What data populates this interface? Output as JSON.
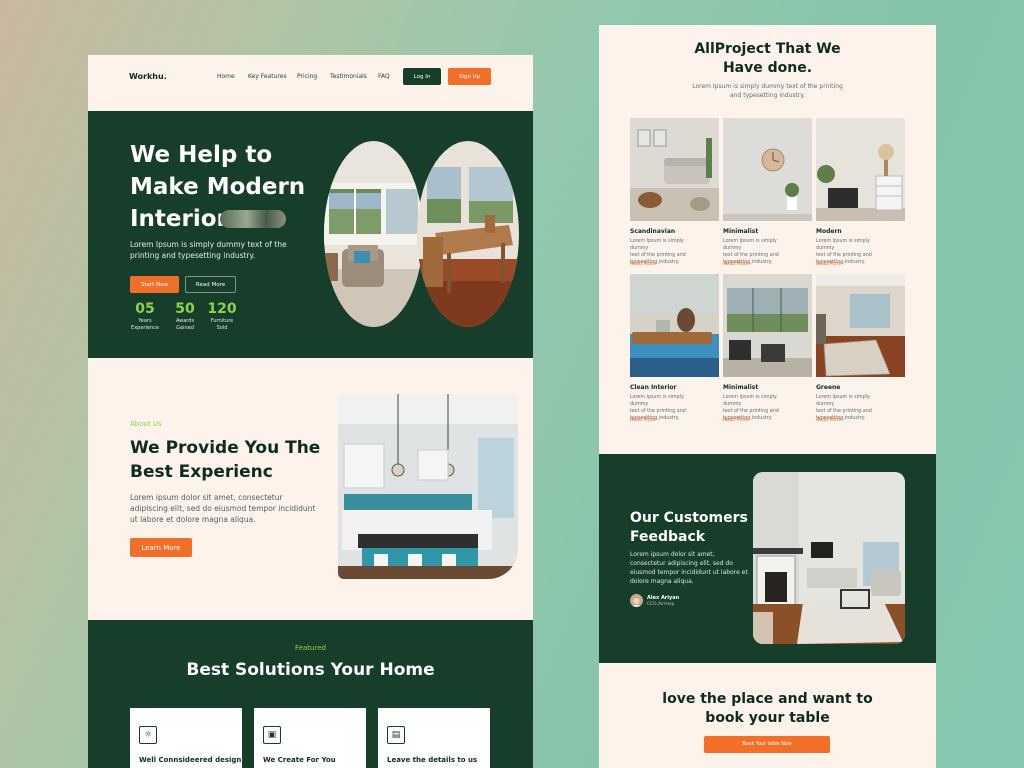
{
  "brand": {
    "logo": "Workhu.",
    "accent": "#f26f29",
    "dark_green": "#173d2b",
    "cream": "#fdf3ea",
    "lime": "#8fd14f"
  },
  "nav": {
    "links": [
      "Home",
      "Key Features",
      "Pricing",
      "Testimonials",
      "FAQ"
    ],
    "login": "Log In",
    "signup": "Sign Up"
  },
  "hero": {
    "title_lines": [
      "We Help to",
      "Make Modern",
      "Interior"
    ],
    "description": "Lorem Ipsum is simply dummy text of the printing and typesetting industry.",
    "start_button": "Start Now",
    "read_more_button": "Read More",
    "stats": [
      {
        "value": "05",
        "label_1": "Years",
        "label_2": "Experience"
      },
      {
        "value": "50",
        "label_1": "Awards",
        "label_2": "Gained"
      },
      {
        "value": "120",
        "label_1": "Furniture",
        "label_2": "Sold"
      }
    ]
  },
  "about": {
    "kicker": "About Us",
    "title_lines": [
      "We Provide You The",
      "Best Experienc"
    ],
    "description": "Lorem ipsum dolor sit amet, consectetur adipiscing elit, sed do eiusmod tempor incididunt ut labore et dolore magna aliqua.",
    "button": "Learn More"
  },
  "featured": {
    "kicker": "Featured",
    "title": "Best Solutions Your Home",
    "cards": [
      {
        "icon": "sun-icon",
        "title": "Well Connsideered design"
      },
      {
        "icon": "create-icon",
        "title": "We Create For You"
      },
      {
        "icon": "chat-icon",
        "title": "Leave the details to us"
      }
    ]
  },
  "projects": {
    "title_lines": [
      "AllProject That We",
      "Have done."
    ],
    "description_lines": [
      "Lorem Ipsum is simply dummy text of the printing",
      "and typesetting industry."
    ],
    "items": [
      {
        "name": "Scandinavian",
        "desc_lines": [
          "Lorem Ipsum is simply dummy",
          "text of the printing and",
          "typesetting industry."
        ],
        "read_more": "Read More"
      },
      {
        "name": "Minimalist",
        "desc_lines": [
          "Lorem Ipsum is simply dummy",
          "text of the printing and",
          "typesetting industry."
        ],
        "read_more": "Read More"
      },
      {
        "name": "Modern",
        "desc_lines": [
          "Lorem Ipsum is simply dummy",
          "text of the printing and",
          "typesetting industry."
        ],
        "read_more": "Read More"
      },
      {
        "name": "Clean Interior",
        "desc_lines": [
          "Lorem Ipsum is simply dummy",
          "text of the printing and",
          "typesetting industry."
        ],
        "read_more": "Read More"
      },
      {
        "name": "Minimalist",
        "desc_lines": [
          "Lorem Ipsum is simply dummy",
          "text of the printing and",
          "typesetting industry."
        ],
        "read_more": "Read More"
      },
      {
        "name": "Greene",
        "desc_lines": [
          "Lorem Ipsum is simply dummy",
          "text of the printing and",
          "typesetting industry."
        ],
        "read_more": "Read More"
      }
    ]
  },
  "feedback": {
    "title_lines": [
      "Our Customers",
      "Feedback"
    ],
    "description": "Lorem ipsum dolor sit amet, consectetur adipiscing elit, sed do eiusmod tempor incididunt ut labore et dolore magna aliqua.",
    "author_name": "Alex Ariyan",
    "author_role": "CEO,AirHelp"
  },
  "booking": {
    "title_lines": [
      "love the place and want to",
      "book your table"
    ],
    "button": "Book Your table Now"
  }
}
